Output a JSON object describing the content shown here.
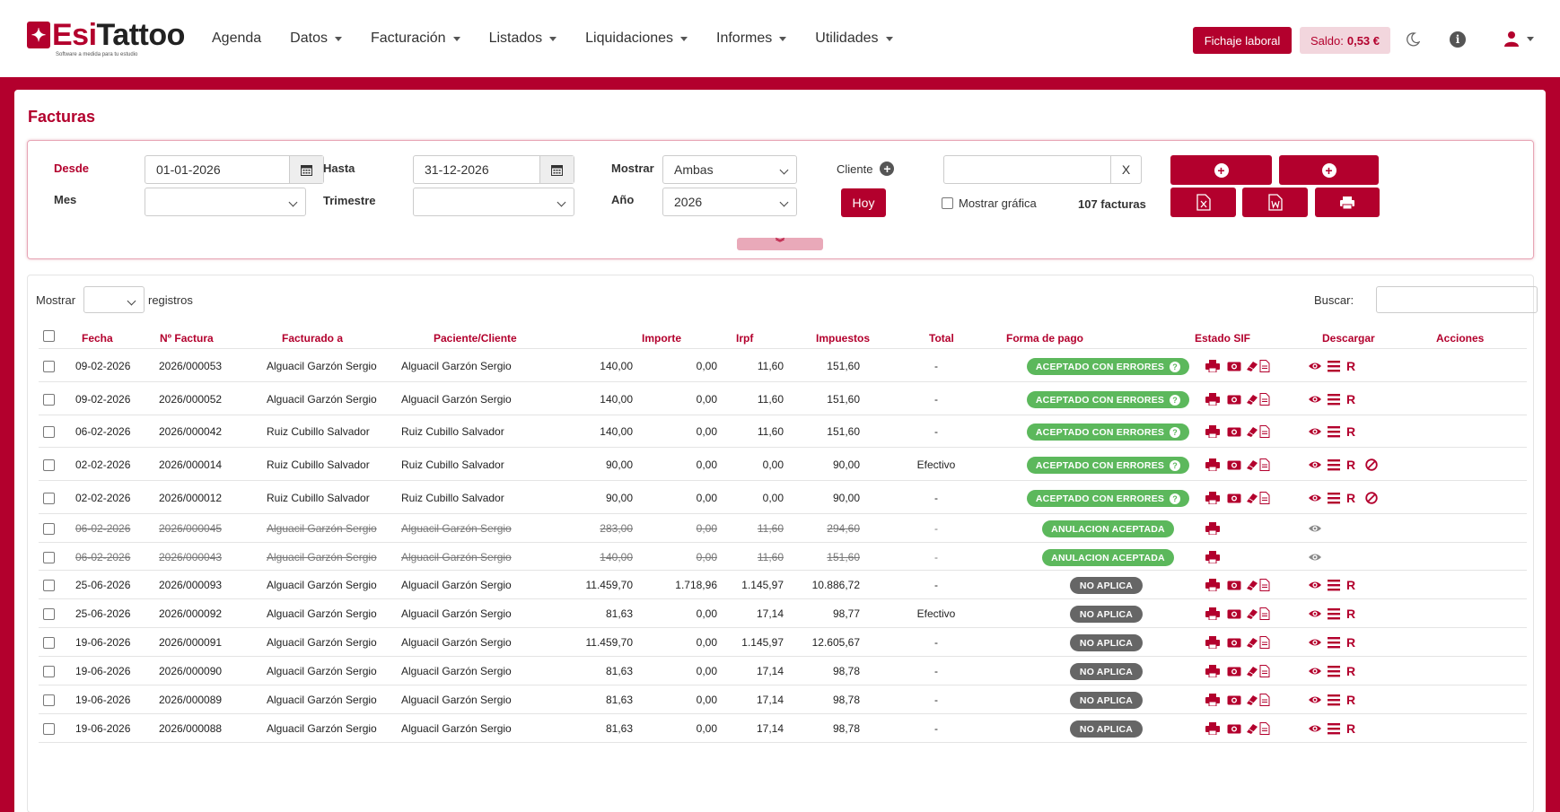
{
  "app": {
    "logo_esi": "Esi",
    "logo_tattoo": "Tattoo",
    "logo_sub": "Software a medida para tu estudio"
  },
  "nav": [
    {
      "label": "Agenda",
      "dropdown": false
    },
    {
      "label": "Datos",
      "dropdown": true
    },
    {
      "label": "Facturación",
      "dropdown": true
    },
    {
      "label": "Listados",
      "dropdown": true
    },
    {
      "label": "Liquidaciones",
      "dropdown": true
    },
    {
      "label": "Informes",
      "dropdown": true
    },
    {
      "label": "Utilidades",
      "dropdown": true
    }
  ],
  "header": {
    "fichaje_label": "Fichaje laboral",
    "saldo_label": "Saldo:",
    "saldo_value": "0,53 €"
  },
  "page": {
    "title": "Facturas"
  },
  "filters": {
    "desde_label": "Desde",
    "desde_value": "01-01-2026",
    "hasta_label": "Hasta",
    "hasta_value": "31-12-2026",
    "mostrar_label": "Mostrar",
    "mostrar_value": "Ambas",
    "cliente_label": "Cliente",
    "mes_label": "Mes",
    "mes_value": "",
    "trimestre_label": "Trimestre",
    "trimestre_value": "",
    "anio_label": "Año",
    "anio_value": "2026",
    "hoy_label": "Hoy",
    "cliente_value": "",
    "clear_label": "X",
    "mostrar_grafica_label": "Mostrar gráfica",
    "count_text": "107 facturas"
  },
  "table_controls": {
    "mostrar_label": "Mostrar",
    "registros_label": "registros",
    "buscar_label": "Buscar:"
  },
  "columns": [
    "Fecha",
    "Nº Factura",
    "Facturado a",
    "Paciente/Cliente",
    "Importe",
    "Irpf",
    "Impuestos",
    "Total",
    "Forma de pago",
    "Estado SIF",
    "Descargar",
    "Acciones"
  ],
  "rows": [
    {
      "fecha": "09-02-2026",
      "num": "2026/000053",
      "facturado": "Alguacil Garzón Sergio",
      "paciente": "Alguacil Garzón Sergio",
      "importe": "140,00",
      "irpf": "0,00",
      "impuestos": "11,60",
      "total": "151,60",
      "pago": "-",
      "estado": "ACEPTADO CON ERRORES",
      "estado_type": "green"
    },
    {
      "fecha": "09-02-2026",
      "num": "2026/000052",
      "facturado": "Alguacil Garzón Sergio",
      "paciente": "Alguacil Garzón Sergio",
      "importe": "140,00",
      "irpf": "0,00",
      "impuestos": "11,60",
      "total": "151,60",
      "pago": "-",
      "estado": "ACEPTADO CON ERRORES",
      "estado_type": "green"
    },
    {
      "fecha": "06-02-2026",
      "num": "2026/000042",
      "facturado": "Ruiz Cubillo Salvador",
      "paciente": "Ruiz Cubillo Salvador",
      "importe": "140,00",
      "irpf": "0,00",
      "impuestos": "11,60",
      "total": "151,60",
      "pago": "-",
      "estado": "ACEPTADO CON ERRORES",
      "estado_type": "green"
    },
    {
      "fecha": "02-02-2026",
      "num": "2026/000014",
      "facturado": "Ruiz Cubillo Salvador",
      "paciente": "Ruiz Cubillo Salvador",
      "importe": "90,00",
      "irpf": "0,00",
      "impuestos": "0,00",
      "total": "90,00",
      "pago": "Efectivo",
      "estado": "ACEPTADO CON ERRORES",
      "estado_type": "green"
    },
    {
      "fecha": "02-02-2026",
      "num": "2026/000012",
      "facturado": "Ruiz Cubillo Salvador",
      "paciente": "Ruiz Cubillo Salvador",
      "importe": "90,00",
      "irpf": "0,00",
      "impuestos": "0,00",
      "total": "90,00",
      "pago": "-",
      "estado": "ACEPTADO CON ERRORES",
      "estado_type": "green"
    },
    {
      "fecha": "06-02-2026",
      "num": "2026/000045",
      "facturado": "Alguacil Garzón Sergio",
      "paciente": "Alguacil Garzón Sergio",
      "importe": "283,00",
      "irpf": "0,00",
      "impuestos": "11,60",
      "total": "294,60",
      "pago": "-",
      "estado": "ANULACION ACEPTADA",
      "estado_type": "green"
    },
    {
      "fecha": "06-02-2026",
      "num": "2026/000043",
      "facturado": "Alguacil Garzón Sergio",
      "paciente": "Alguacil Garzón Sergio",
      "importe": "140,00",
      "irpf": "0,00",
      "impuestos": "11,60",
      "total": "151,60",
      "pago": "-",
      "estado": "ANULACION ACEPTADA",
      "estado_type": "green"
    },
    {
      "fecha": "25-06-2026",
      "num": "2026/000093",
      "facturado": "Alguacil Garzón Sergio",
      "paciente": "Alguacil Garzón Sergio",
      "importe": "11.459,70",
      "irpf": "1.718,96",
      "impuestos": "1.145,97",
      "total": "10.886,72",
      "pago": "-",
      "estado": "NO APLICA",
      "estado_type": "gray"
    },
    {
      "fecha": "25-06-2026",
      "num": "2026/000092",
      "facturado": "Alguacil Garzón Sergio",
      "paciente": "Alguacil Garzón Sergio",
      "importe": "81,63",
      "irpf": "0,00",
      "impuestos": "17,14",
      "total": "98,77",
      "pago": "Efectivo",
      "estado": "NO APLICA",
      "estado_type": "gray"
    },
    {
      "fecha": "19-06-2026",
      "num": "2026/000091",
      "facturado": "Alguacil Garzón Sergio",
      "paciente": "Alguacil Garzón Sergio",
      "importe": "11.459,70",
      "irpf": "0,00",
      "impuestos": "1.145,97",
      "total": "12.605,67",
      "pago": "-",
      "estado": "NO APLICA",
      "estado_type": "gray"
    },
    {
      "fecha": "19-06-2026",
      "num": "2026/000090",
      "facturado": "Alguacil Garzón Sergio",
      "paciente": "Alguacil Garzón Sergio",
      "importe": "81,63",
      "irpf": "0,00",
      "impuestos": "17,14",
      "total": "98,78",
      "pago": "-",
      "estado": "NO APLICA",
      "estado_type": "gray"
    },
    {
      "fecha": "19-06-2026",
      "num": "2026/000089",
      "facturado": "Alguacil Garzón Sergio",
      "paciente": "Alguacil Garzón Sergio",
      "importe": "81,63",
      "irpf": "0,00",
      "impuestos": "17,14",
      "total": "98,78",
      "pago": "-",
      "estado": "NO APLICA",
      "estado_type": "gray"
    },
    {
      "fecha": "19-06-2026",
      "num": "2026/000088",
      "facturado": "Alguacil Garzón Sergio",
      "paciente": "Alguacil Garzón Sergio",
      "importe": "81,63",
      "irpf": "0,00",
      "impuestos": "17,14",
      "total": "98,78",
      "pago": "-",
      "estado": "NO APLICA",
      "estado_type": "gray"
    }
  ],
  "actions": {
    "r_label": "R"
  },
  "colors": {
    "brand": "#b3002d",
    "success": "#5cb85c",
    "neutral": "#666666"
  }
}
